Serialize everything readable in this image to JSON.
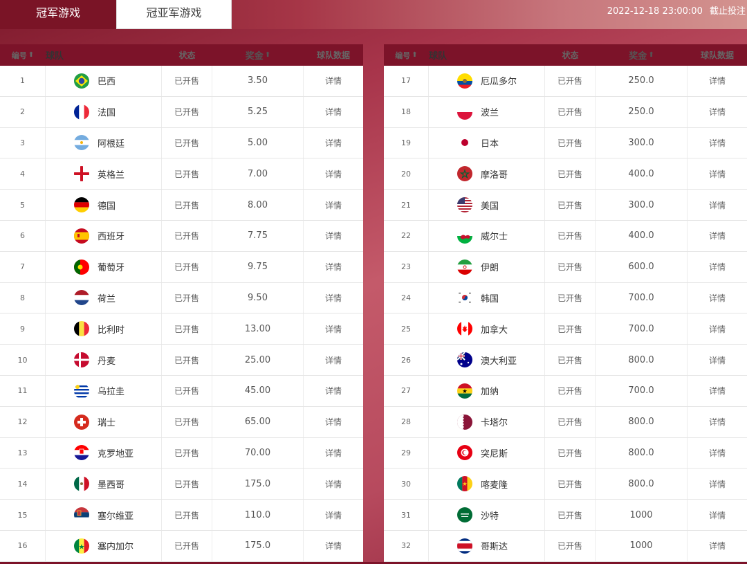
{
  "tabs": {
    "champion": "冠军游戏",
    "runner_up": "冠亚军游戏"
  },
  "deadline": {
    "datetime": "2022-12-18 23:00:00",
    "label": "截止投注"
  },
  "columns": {
    "no": "编号",
    "team": "球队",
    "status": "状态",
    "prize": "奖金",
    "data": "球队数据"
  },
  "sort_icon": "up-arrow-icon",
  "left_teams": [
    {
      "no": "1",
      "team": "巴西",
      "flag": "brazil-flag-icon",
      "status": "已开售",
      "prize": "3.50",
      "data": "详情"
    },
    {
      "no": "2",
      "team": "法国",
      "flag": "france-flag-icon",
      "status": "已开售",
      "prize": "5.25",
      "data": "详情"
    },
    {
      "no": "3",
      "team": "阿根廷",
      "flag": "argentina-flag-icon",
      "status": "已开售",
      "prize": "5.00",
      "data": "详情"
    },
    {
      "no": "4",
      "team": "英格兰",
      "flag": "england-flag-icon",
      "status": "已开售",
      "prize": "7.00",
      "data": "详情"
    },
    {
      "no": "5",
      "team": "德国",
      "flag": "germany-flag-icon",
      "status": "已开售",
      "prize": "8.00",
      "data": "详情"
    },
    {
      "no": "6",
      "team": "西班牙",
      "flag": "spain-flag-icon",
      "status": "已开售",
      "prize": "7.75",
      "data": "详情"
    },
    {
      "no": "7",
      "team": "葡萄牙",
      "flag": "portugal-flag-icon",
      "status": "已开售",
      "prize": "9.75",
      "data": "详情"
    },
    {
      "no": "8",
      "team": "荷兰",
      "flag": "netherlands-flag-icon",
      "status": "已开售",
      "prize": "9.50",
      "data": "详情"
    },
    {
      "no": "9",
      "team": "比利时",
      "flag": "belgium-flag-icon",
      "status": "已开售",
      "prize": "13.00",
      "data": "详情"
    },
    {
      "no": "10",
      "team": "丹麦",
      "flag": "denmark-flag-icon",
      "status": "已开售",
      "prize": "25.00",
      "data": "详情"
    },
    {
      "no": "11",
      "team": "乌拉圭",
      "flag": "uruguay-flag-icon",
      "status": "已开售",
      "prize": "45.00",
      "data": "详情"
    },
    {
      "no": "12",
      "team": "瑞士",
      "flag": "switzerland-flag-icon",
      "status": "已开售",
      "prize": "65.00",
      "data": "详情"
    },
    {
      "no": "13",
      "team": "克罗地亚",
      "flag": "croatia-flag-icon",
      "status": "已开售",
      "prize": "70.00",
      "data": "详情"
    },
    {
      "no": "14",
      "team": "墨西哥",
      "flag": "mexico-flag-icon",
      "status": "已开售",
      "prize": "175.0",
      "data": "详情"
    },
    {
      "no": "15",
      "team": "塞尔维亚",
      "flag": "serbia-flag-icon",
      "status": "已开售",
      "prize": "110.0",
      "data": "详情"
    },
    {
      "no": "16",
      "team": "塞内加尔",
      "flag": "senegal-flag-icon",
      "status": "已开售",
      "prize": "175.0",
      "data": "详情"
    }
  ],
  "right_teams": [
    {
      "no": "17",
      "team": "厄瓜多尔",
      "flag": "ecuador-flag-icon",
      "status": "已开售",
      "prize": "250.0",
      "data": "详情"
    },
    {
      "no": "18",
      "team": "波兰",
      "flag": "poland-flag-icon",
      "status": "已开售",
      "prize": "250.0",
      "data": "详情"
    },
    {
      "no": "19",
      "team": "日本",
      "flag": "japan-flag-icon",
      "status": "已开售",
      "prize": "300.0",
      "data": "详情"
    },
    {
      "no": "20",
      "team": "摩洛哥",
      "flag": "morocco-flag-icon",
      "status": "已开售",
      "prize": "400.0",
      "data": "详情"
    },
    {
      "no": "21",
      "team": "美国",
      "flag": "usa-flag-icon",
      "status": "已开售",
      "prize": "300.0",
      "data": "详情"
    },
    {
      "no": "22",
      "team": "威尔士",
      "flag": "wales-flag-icon",
      "status": "已开售",
      "prize": "400.0",
      "data": "详情"
    },
    {
      "no": "23",
      "team": "伊朗",
      "flag": "iran-flag-icon",
      "status": "已开售",
      "prize": "600.0",
      "data": "详情"
    },
    {
      "no": "24",
      "team": "韩国",
      "flag": "korea-flag-icon",
      "status": "已开售",
      "prize": "700.0",
      "data": "详情"
    },
    {
      "no": "25",
      "team": "加拿大",
      "flag": "canada-flag-icon",
      "status": "已开售",
      "prize": "700.0",
      "data": "详情"
    },
    {
      "no": "26",
      "team": "澳大利亚",
      "flag": "australia-flag-icon",
      "status": "已开售",
      "prize": "800.0",
      "data": "详情"
    },
    {
      "no": "27",
      "team": "加纳",
      "flag": "ghana-flag-icon",
      "status": "已开售",
      "prize": "700.0",
      "data": "详情"
    },
    {
      "no": "28",
      "team": "卡塔尔",
      "flag": "qatar-flag-icon",
      "status": "已开售",
      "prize": "800.0",
      "data": "详情"
    },
    {
      "no": "29",
      "team": "突尼斯",
      "flag": "tunisia-flag-icon",
      "status": "已开售",
      "prize": "800.0",
      "data": "详情"
    },
    {
      "no": "30",
      "team": "喀麦隆",
      "flag": "cameroon-flag-icon",
      "status": "已开售",
      "prize": "800.0",
      "data": "详情"
    },
    {
      "no": "31",
      "team": "沙特",
      "flag": "saudi-flag-icon",
      "status": "已开售",
      "prize": "1000",
      "data": "详情"
    },
    {
      "no": "32",
      "team": "哥斯达",
      "flag": "costarica-flag-icon",
      "status": "已开售",
      "prize": "1000",
      "data": "详情"
    }
  ],
  "colors": {
    "header_bg": "#7c1329",
    "tab_active_bg": "#7a1426"
  }
}
